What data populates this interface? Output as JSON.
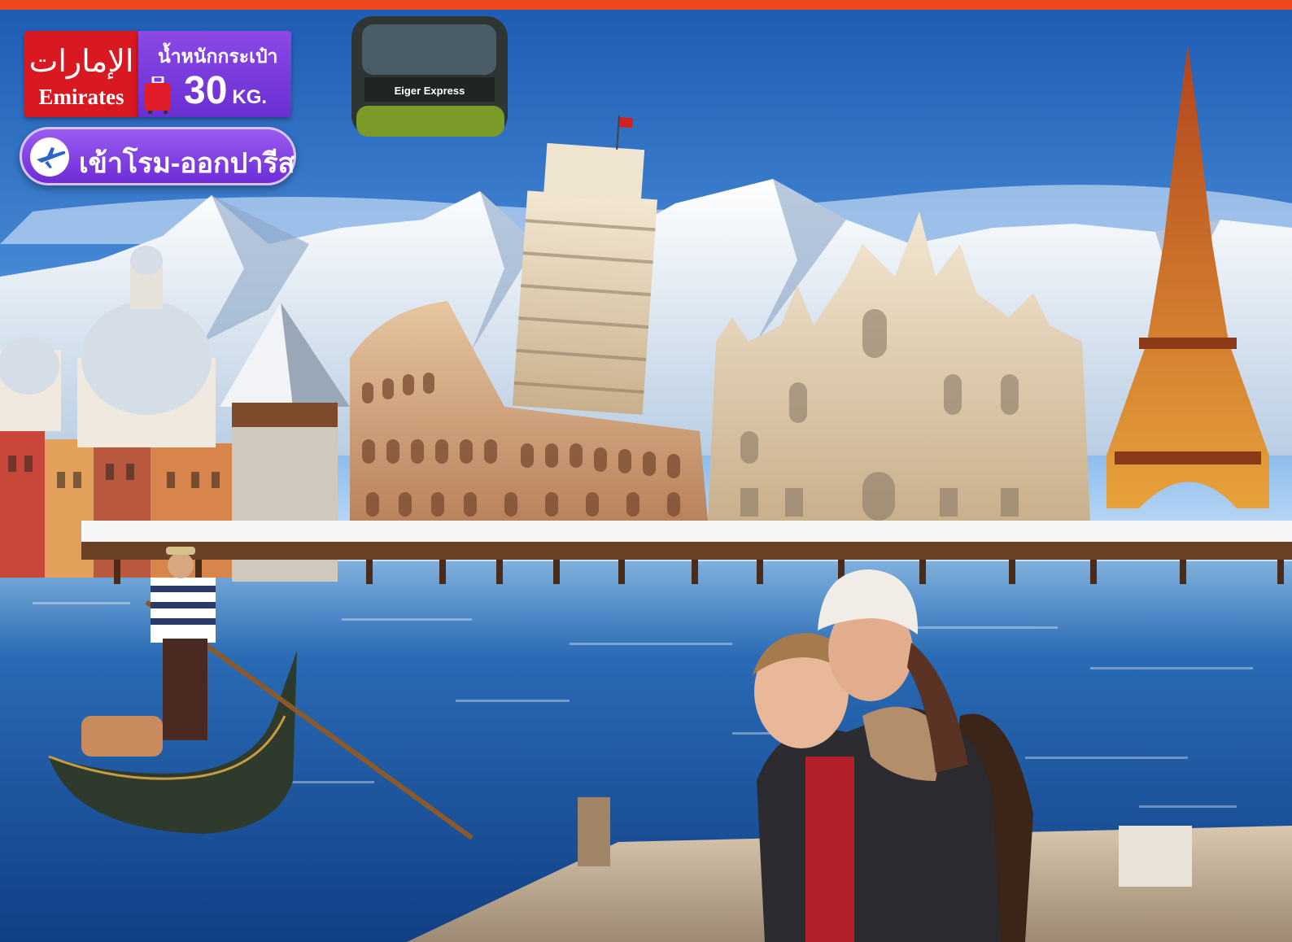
{
  "airline": {
    "logo_arabic": "الإمارات",
    "name": "Emirates"
  },
  "baggage": {
    "label": "น้ำหนักกระเป๋า",
    "weight": "30",
    "unit": "KG."
  },
  "route": {
    "text": "เข้าโรม-ออกปารีส"
  },
  "cable_car": {
    "label": "Eiger Express"
  },
  "colors": {
    "top_bar": "#f0481d",
    "emirates_red": "#d81921",
    "purple": "#7a3ce0",
    "sky_top": "#1f5fb6",
    "water": "#1c4f95"
  }
}
